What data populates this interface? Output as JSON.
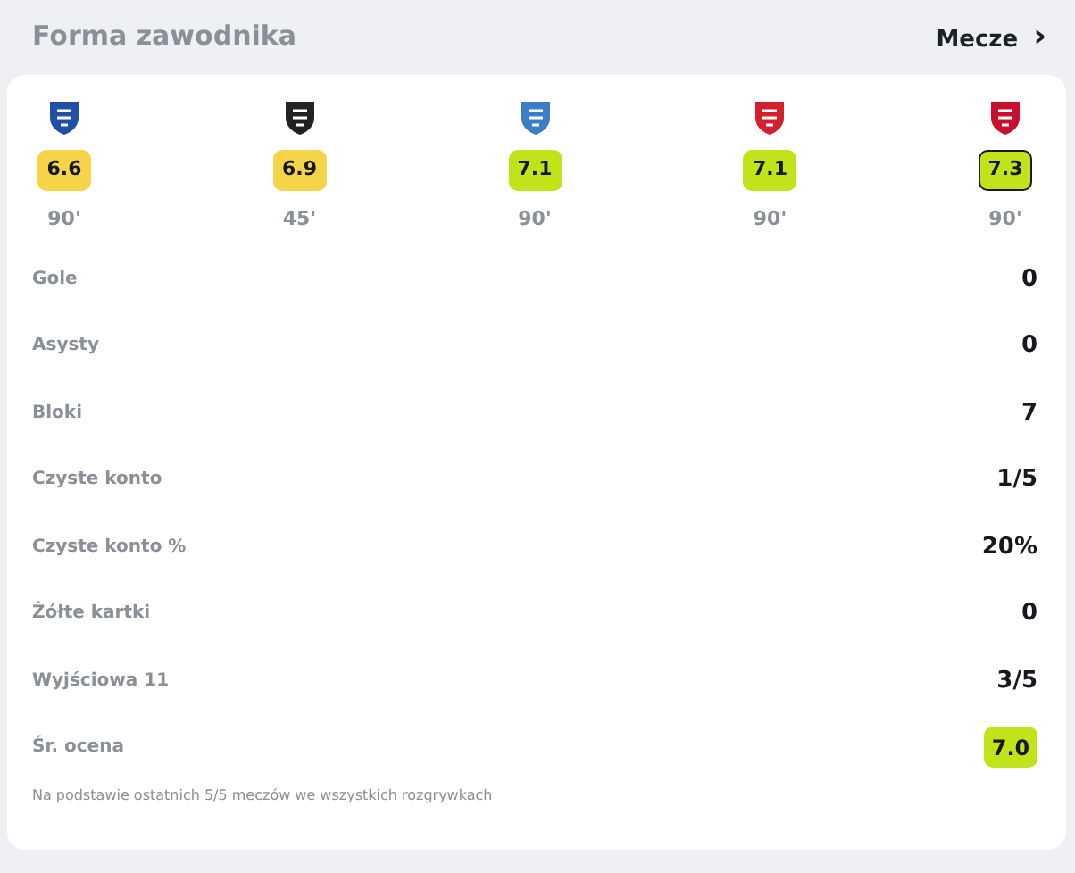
{
  "header": {
    "title": "Forma zawodnika",
    "link": "Mecze",
    "link_icon": "›"
  },
  "matches": [
    {
      "crest": {
        "color": "#1f4fa8"
      },
      "rating": {
        "value": "6.6",
        "color": "#f5d547",
        "highlighted": false
      },
      "minutes": "90'"
    },
    {
      "crest": {
        "color": "#222222"
      },
      "rating": {
        "value": "6.9",
        "color": "#f5d547",
        "highlighted": false
      },
      "minutes": "45'"
    },
    {
      "crest": {
        "color": "#3b7ec8"
      },
      "rating": {
        "value": "7.1",
        "color": "#c0e31a",
        "highlighted": false
      },
      "minutes": "90'"
    },
    {
      "crest": {
        "color": "#d3202f"
      },
      "rating": {
        "value": "7.1",
        "color": "#c0e31a",
        "highlighted": false
      },
      "minutes": "90'"
    },
    {
      "crest": {
        "color": "#c8102e"
      },
      "rating": {
        "value": "7.3",
        "color": "#c0e31a",
        "highlighted": true
      },
      "minutes": "90'"
    }
  ],
  "stats": [
    {
      "label": "Gole",
      "value": "0",
      "kind": "plain"
    },
    {
      "label": "Asysty",
      "value": "0",
      "kind": "plain"
    },
    {
      "label": "Bloki",
      "value": "7",
      "kind": "plain"
    },
    {
      "label": "Czyste konto",
      "value": "1/5",
      "kind": "plain"
    },
    {
      "label": "Czyste konto %",
      "value": "20%",
      "kind": "plain"
    },
    {
      "label": "Żółte kartki",
      "value": "0",
      "kind": "plain"
    },
    {
      "label": "Wyjściowa 11",
      "value": "3/5",
      "kind": "plain"
    },
    {
      "label": "Śr. ocena",
      "value": "7.0",
      "kind": "rating",
      "color": "#c0e31a"
    }
  ],
  "footnote": "Na podstawie ostatnich 5/5 meczów we wszystkich rozgrywkach"
}
